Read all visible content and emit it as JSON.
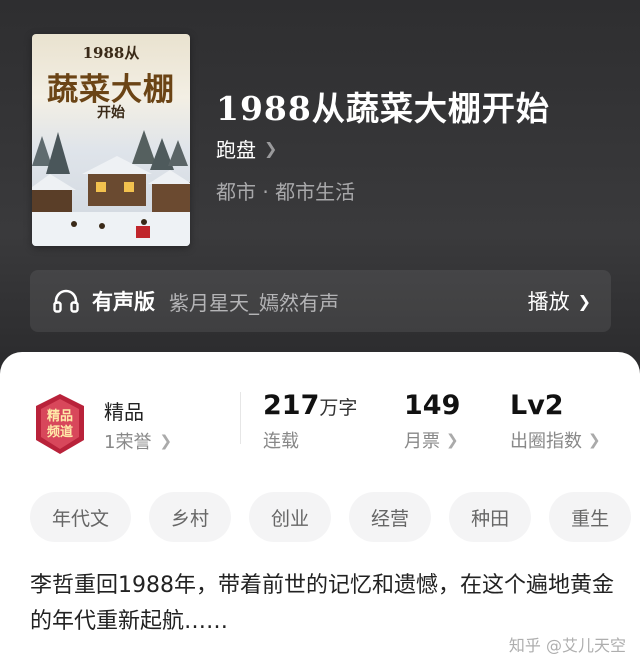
{
  "book": {
    "cover": {
      "sub": "1988从",
      "title": "蔬菜大棚",
      "small": "开始"
    },
    "title": "1988从蔬菜大棚开始",
    "author": "跑盘",
    "genre": "都市 · 都市生活"
  },
  "audio": {
    "label": "有声版",
    "narrator": "紫月星天_嫣然有声",
    "play_label": "播放"
  },
  "honor": {
    "title": "精品",
    "sub": "1荣誉"
  },
  "stats": [
    {
      "value": "217",
      "unit": "万字",
      "label": "连载"
    },
    {
      "value": "149",
      "unit": "",
      "label": "月票"
    },
    {
      "value": "Lv2",
      "unit": "",
      "label": "出圈指数"
    }
  ],
  "tags": [
    "年代文",
    "乡村",
    "创业",
    "经营",
    "种田",
    "重生"
  ],
  "description": "李哲重回1988年，带着前世的记忆和遗憾，在这个遍地黄金的年代重新起航……",
  "watermark": "知乎 @艾儿天空",
  "colors": {
    "header_bg": "#2e2e30",
    "sheet_bg": "#ffffff",
    "tag_bg": "#f4f4f5",
    "badge_red": "#b9223a"
  }
}
